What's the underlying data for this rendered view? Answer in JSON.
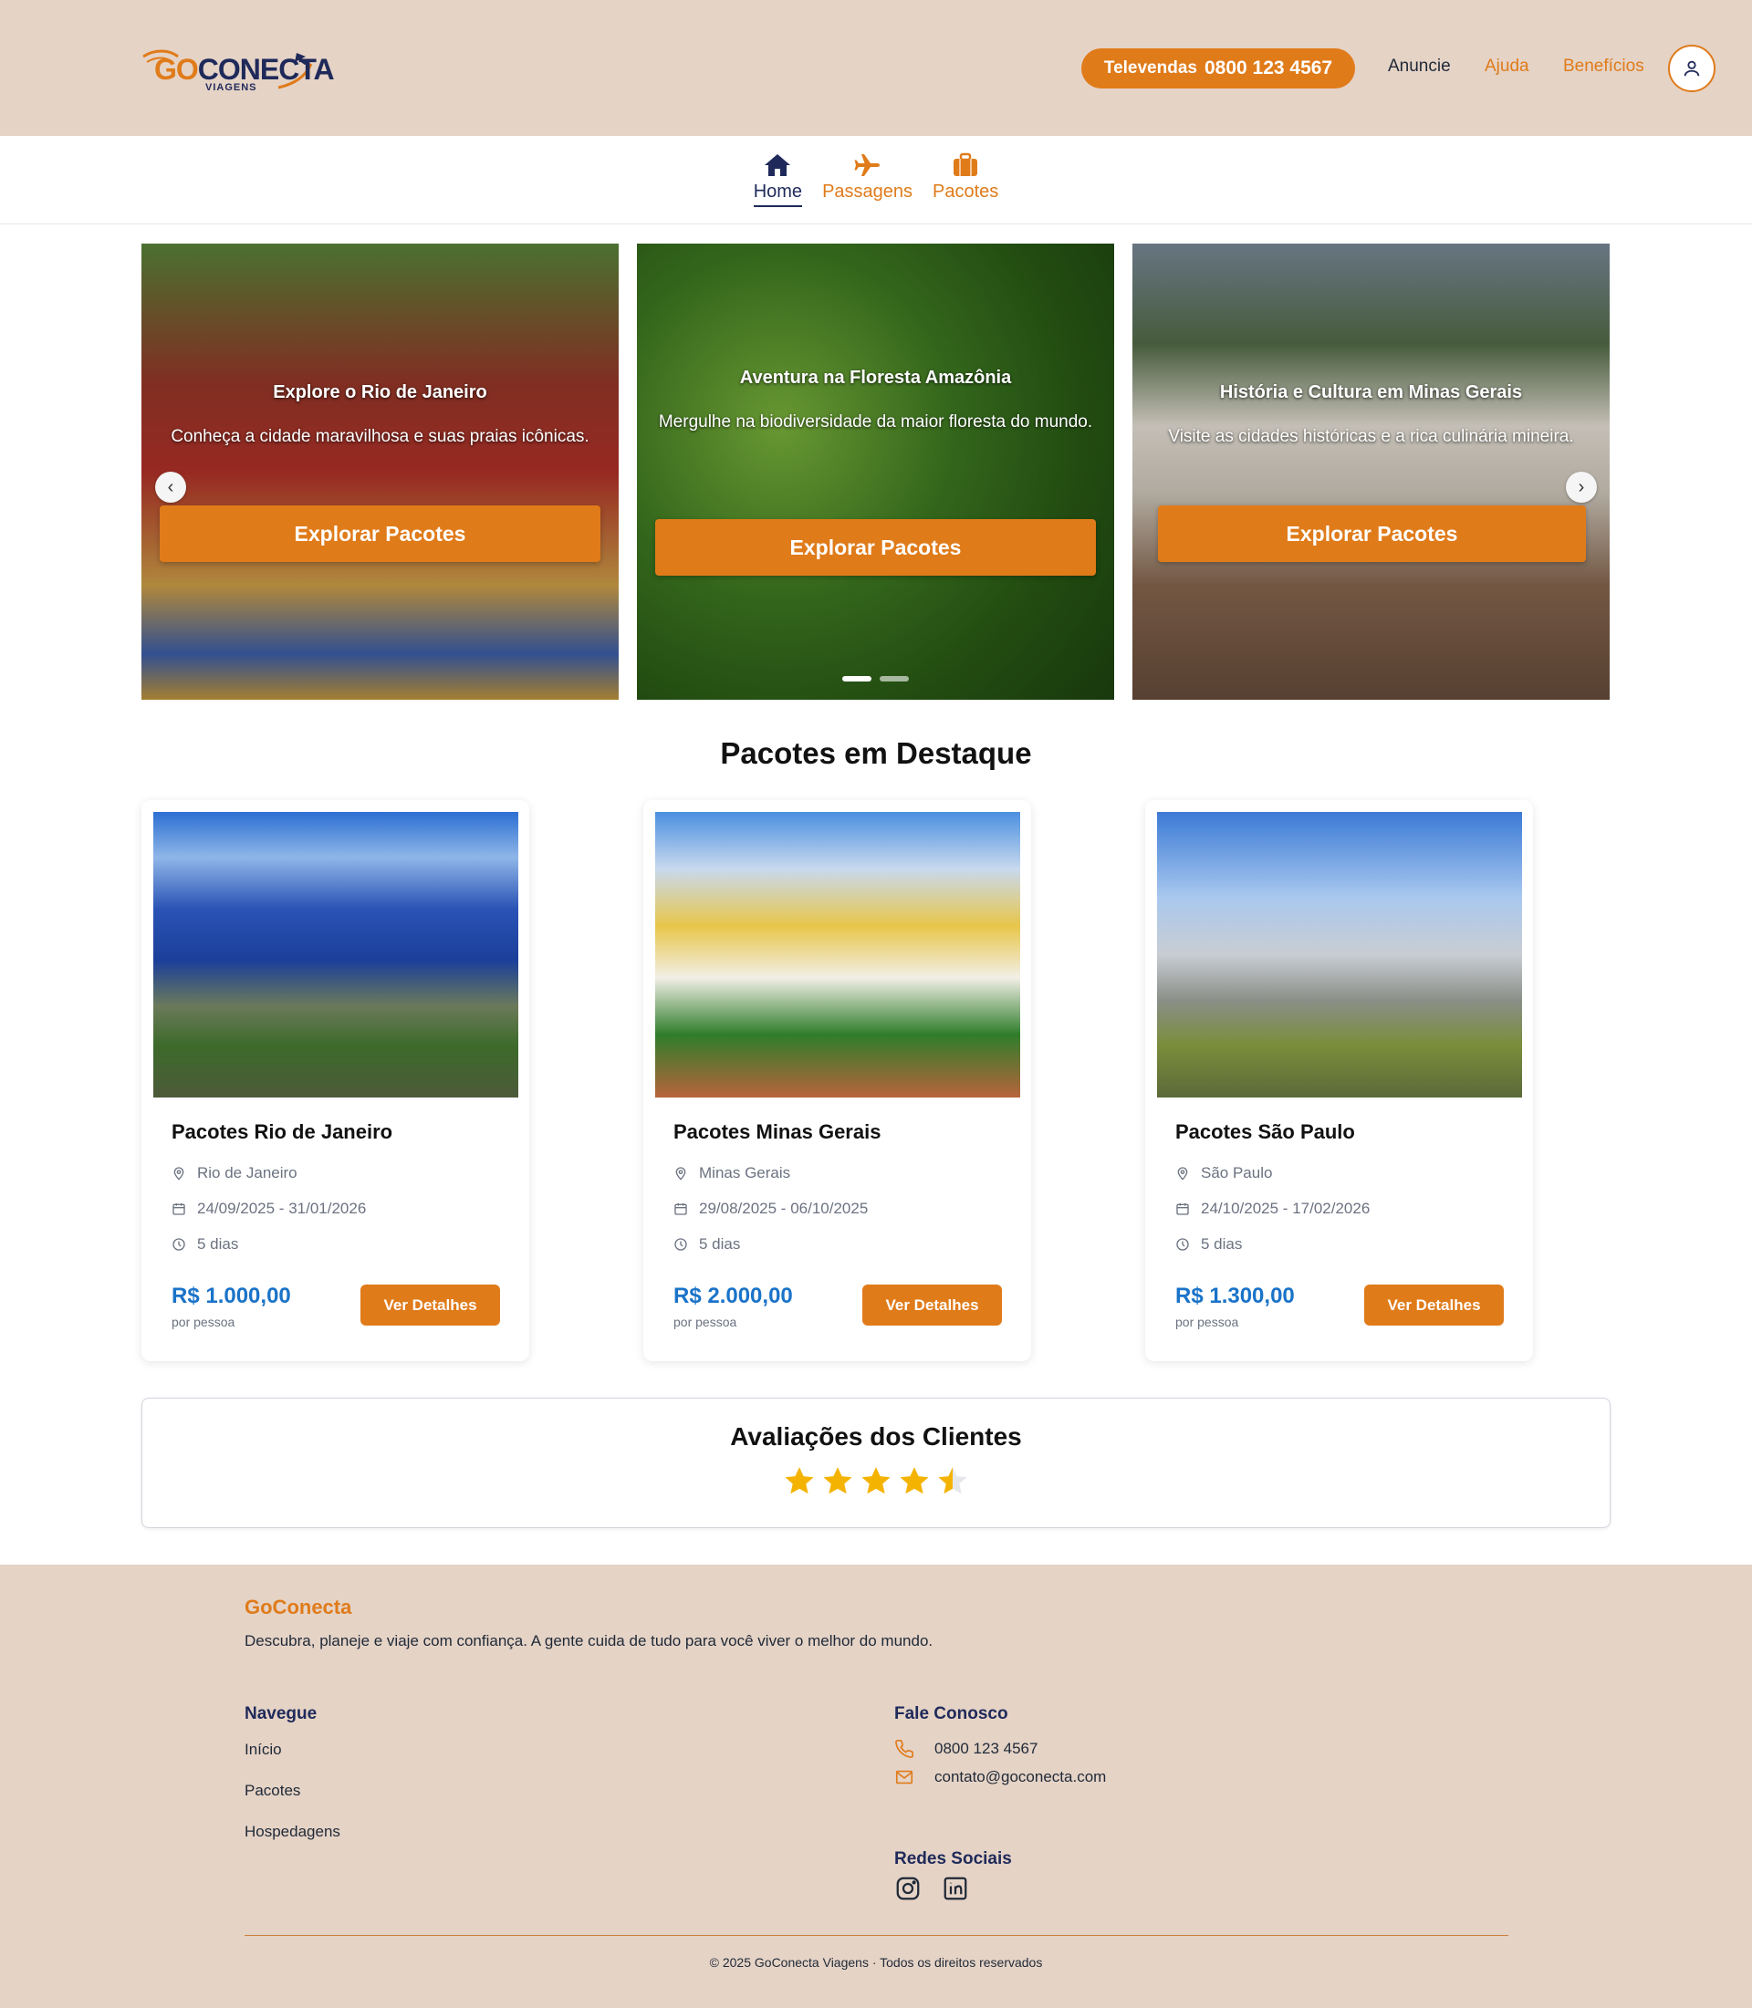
{
  "header": {
    "logo_go": "GO",
    "logo_conecta": "CONECTA",
    "logo_sub": "VIAGENS",
    "televendas_label": "Televendas",
    "televendas_number": "0800 123 4567",
    "links": {
      "anuncie": "Anuncie",
      "ajuda": "Ajuda",
      "beneficios": "Benefícios"
    },
    "user_icon": "user-icon"
  },
  "tabs": [
    {
      "label": "Home",
      "icon": "home-icon",
      "active": true
    },
    {
      "label": "Passagens",
      "icon": "plane-icon",
      "active": false
    },
    {
      "label": "Pacotes",
      "icon": "suitcase-icon",
      "active": false
    }
  ],
  "carousel": {
    "slides": [
      {
        "title": "Explore o Rio de Janeiro",
        "desc": "Conheça a cidade maravilhosa e suas praias icônicas.",
        "cta": "Explorar Pacotes"
      },
      {
        "title": "Aventura na Floresta Amazônia",
        "desc": "Mergulhe na biodiversidade da maior floresta do mundo.",
        "cta": "Explorar Pacotes"
      },
      {
        "title": "História e Cultura em Minas Gerais",
        "desc": "Visite as cidades históricas e a rica culinária mineira.",
        "cta": "Explorar Pacotes"
      }
    ],
    "prev": "‹",
    "next": "›",
    "active_dot": 1,
    "dot_count": 2
  },
  "featured": {
    "title": "Pacotes em Destaque",
    "cards": [
      {
        "title": "Pacotes Rio de Janeiro",
        "location": "Rio de Janeiro",
        "dates": "24/09/2025 - 31/01/2026",
        "duration": "5 dias",
        "price": "R$ 1.000,00",
        "per": "por pessoa",
        "button": "Ver Detalhes"
      },
      {
        "title": "Pacotes Minas Gerais",
        "location": "Minas Gerais",
        "dates": "29/08/2025 - 06/10/2025",
        "duration": "5 dias",
        "price": "R$ 2.000,00",
        "per": "por pessoa",
        "button": "Ver Detalhes"
      },
      {
        "title": "Pacotes São Paulo",
        "location": "São Paulo",
        "dates": "24/10/2025 - 17/02/2026",
        "duration": "5 dias",
        "price": "R$ 1.300,00",
        "per": "por pessoa",
        "button": "Ver Detalhes"
      }
    ]
  },
  "reviews": {
    "title": "Avaliações dos Clientes",
    "rating": 4.5,
    "max": 5
  },
  "footer": {
    "brand": "GoConecta",
    "tagline": "Descubra, planeje e viaje com confiança. A gente cuida de tudo para você viver o melhor do mundo.",
    "nav_heading": "Navegue",
    "nav_links": [
      "Início",
      "Pacotes",
      "Hospedagens"
    ],
    "contact_heading": "Fale Conosco",
    "phone": "0800 123 4567",
    "email": "contato@goconecta.com",
    "social_heading": "Redes Sociais",
    "social_icons": [
      "instagram-icon",
      "linkedin-icon"
    ],
    "copyright": "© 2025 GoConecta Viagens · Todos os direitos reservados"
  },
  "colors": {
    "accent": "#e07b1a",
    "navy": "#1f2a5a",
    "beige": "#e5d3c6",
    "price_blue": "#1a73c8",
    "star": "#f5b301"
  }
}
